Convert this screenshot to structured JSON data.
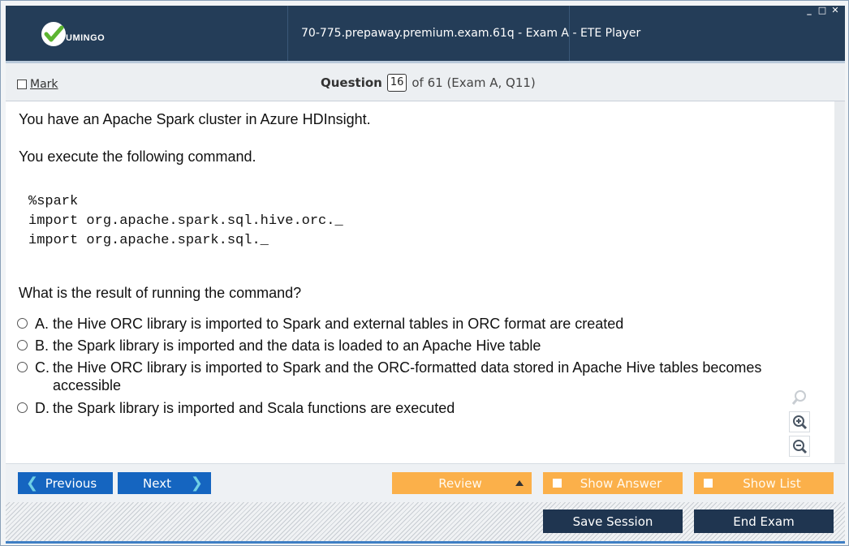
{
  "titlebar": {
    "logo_text": "UMINGO",
    "window_title": "70-775.prepaway.premium.exam.61q - Exam A - ETE Player",
    "controls": {
      "minimize": "_",
      "maximize": "□",
      "close": "✕"
    }
  },
  "qbar": {
    "mark_label": "Mark",
    "question_label": "Question",
    "question_number": "16",
    "question_of": "of 61 (Exam A, Q11)"
  },
  "question": {
    "line1": "You have an Apache Spark cluster in Azure HDInsight.",
    "line2": "You execute the following command.",
    "code": "%spark\nimport org.apache.spark.sql.hive.orc._\nimport org.apache.spark.sql._",
    "prompt": "What is the result of running the command?",
    "options": [
      {
        "letter": "A.",
        "text": "the Hive ORC library is imported to Spark and external tables in ORC format are created"
      },
      {
        "letter": "B.",
        "text": "the Spark library is imported and the data is loaded to an Apache Hive table"
      },
      {
        "letter": "C.",
        "text": "the Hive ORC library is imported to Spark and the ORC-formatted data stored in Apache Hive tables becomes accessible"
      },
      {
        "letter": "D.",
        "text": "the Spark library is imported and Scala functions are executed"
      }
    ]
  },
  "tools": {
    "icons": [
      "search-icon",
      "zoom-in-icon",
      "zoom-out-icon"
    ]
  },
  "nav": {
    "previous": "Previous",
    "next": "Next",
    "review": "Review",
    "show_answer": "Show Answer",
    "show_list": "Show List"
  },
  "footer": {
    "save_session": "Save Session",
    "end_exam": "End Exam"
  },
  "colors": {
    "titlebar": "#243d58",
    "nav_blue": "#1565c0",
    "nav_orange": "#fbb04a",
    "footer_button": "#1f3550"
  }
}
